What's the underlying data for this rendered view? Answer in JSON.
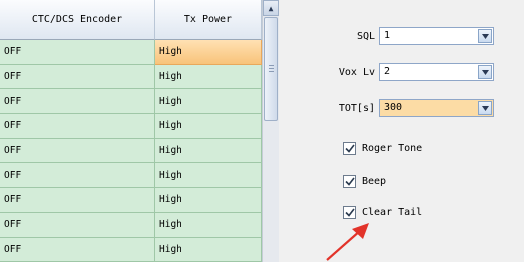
{
  "grid": {
    "columns": [
      "CTC/DCS Encoder",
      "Tx Power"
    ],
    "rows": [
      {
        "encoder": "OFF",
        "power": "High",
        "selected": true
      },
      {
        "encoder": "OFF",
        "power": "High"
      },
      {
        "encoder": "OFF",
        "power": "High"
      },
      {
        "encoder": "OFF",
        "power": "High"
      },
      {
        "encoder": "OFF",
        "power": "High"
      },
      {
        "encoder": "OFF",
        "power": "High"
      },
      {
        "encoder": "OFF",
        "power": "High"
      },
      {
        "encoder": "OFF",
        "power": "High"
      },
      {
        "encoder": "OFF",
        "power": "High"
      }
    ]
  },
  "settings": {
    "sql": {
      "label": "SQL",
      "value": "1"
    },
    "vox": {
      "label": "Vox Lv",
      "value": "2"
    },
    "tot": {
      "label": "TOT[s]",
      "value": "300"
    }
  },
  "checkboxes": {
    "roger_tone": {
      "label": "Roger Tone",
      "checked": true
    },
    "beep": {
      "label": "Beep",
      "checked": true
    },
    "clear_tail": {
      "label": "Clear Tail",
      "checked": true
    }
  },
  "colors": {
    "row_bg": "#d3ecd8",
    "selected_cell": "#f8c37a",
    "annotation_arrow": "#e2332a"
  }
}
